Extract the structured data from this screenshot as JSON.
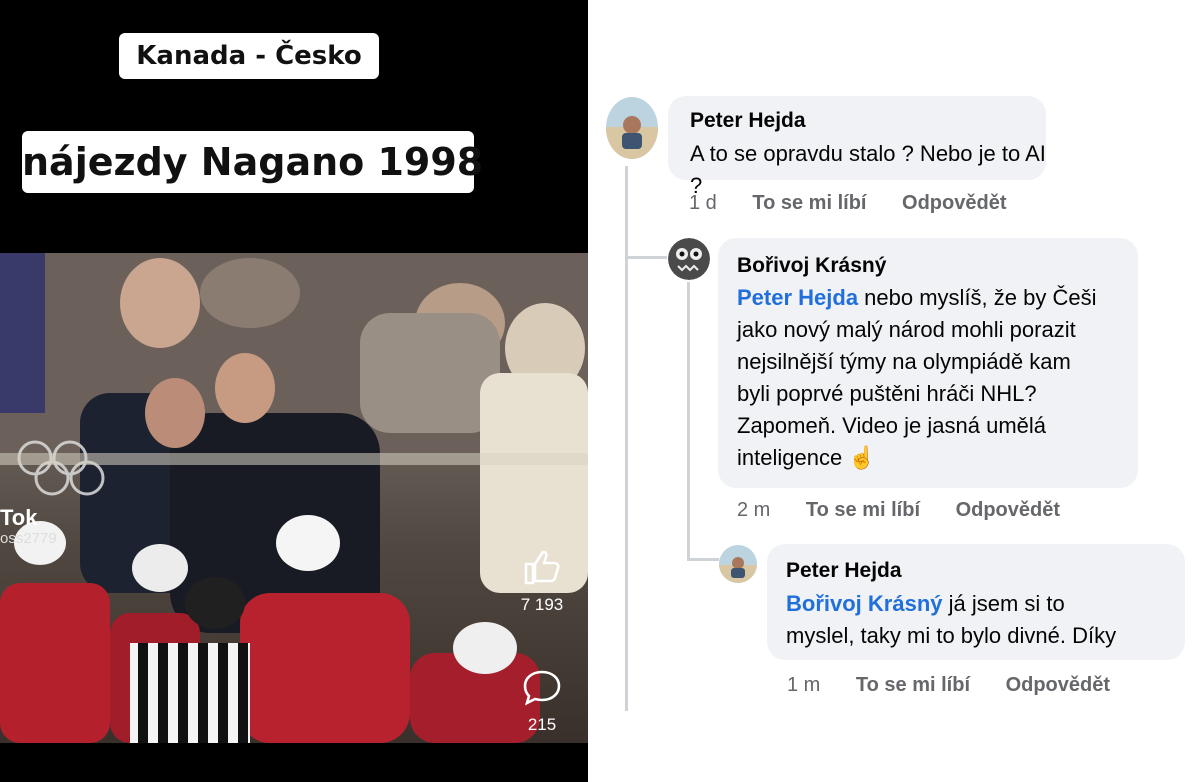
{
  "video": {
    "caption_top": "Kanada - Česko",
    "caption_main": "nájezdy Nagano 1998",
    "brand": "Tok",
    "username": "oss2779",
    "likes": "7 193",
    "comments": "215"
  },
  "comments": [
    {
      "author": "Peter Hejda",
      "text": "A to se opravdu stalo ? Nebo je to AI ?",
      "time": "1 d",
      "like_label": "To se mi líbí",
      "reply_label": "Odpovědět"
    },
    {
      "author": "Bořivoj Krásný",
      "mention": "Peter Hejda",
      "lines": [
        " nebo myslíš, že by Češi",
        "jako nový malý národ mohli porazit",
        "nejsilnější týmy na olympiádě kam",
        "byli poprvé puštěni hráči NHL?",
        "Zapomeň. Video je jasná umělá",
        "inteligence"
      ],
      "emoji": "☝",
      "time": "2 m",
      "like_label": "To se mi líbí",
      "reply_label": "Odpovědět"
    },
    {
      "author": "Peter Hejda",
      "mention": "Bořivoj Krásný",
      "lines": [
        " já jsem si to",
        "myslel, taky mi to bylo divné. Díky"
      ],
      "time": "1 m",
      "like_label": "To se mi líbí",
      "reply_label": "Odpovědět"
    }
  ]
}
